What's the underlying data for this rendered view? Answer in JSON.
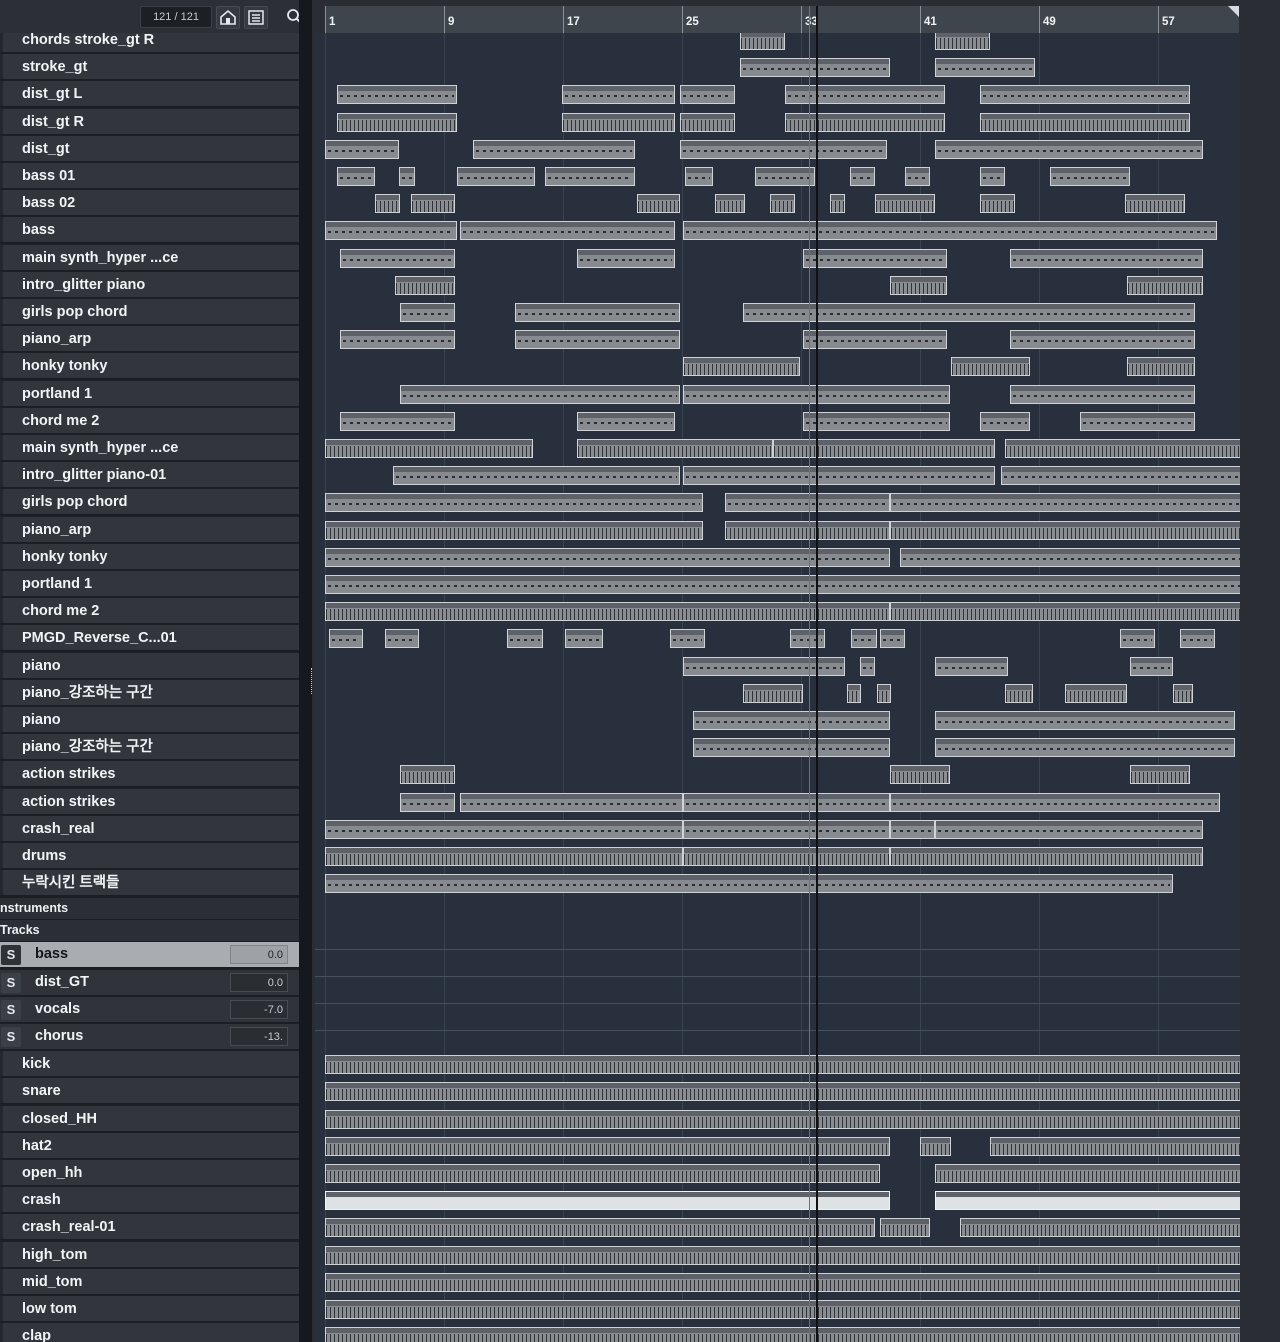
{
  "toolbar": {
    "track_counter": "121 / 121",
    "icons": [
      "home-icon",
      "list-icon",
      "search-icon"
    ]
  },
  "ruler": {
    "bars": [
      "1",
      "9",
      "17",
      "25",
      "33",
      "41",
      "49",
      "57"
    ]
  },
  "tracks_top": [
    "chords stroke_gt R",
    "stroke_gt",
    "dist_gt L",
    "dist_gt R",
    "dist_gt",
    "bass 01",
    "bass 02",
    "bass",
    "main synth_hyper ...ce",
    "intro_glitter piano",
    "girls pop chord",
    "piano_arp",
    "honky tonky",
    "portland 1",
    "chord me 2",
    "main synth_hyper ...ce",
    "intro_glitter piano-01",
    "girls pop chord",
    "piano_arp",
    "honky tonky",
    "portland 1",
    "chord me 2",
    "PMGD_Reverse_C...01",
    "piano",
    "piano_강조하는 구간",
    "piano",
    "piano_강조하는 구간",
    "action strikes",
    "action strikes",
    "crash_real",
    "drums",
    "누락시킨 트랙들"
  ],
  "folders": {
    "instruments": "nstruments",
    "tracks": "Tracks"
  },
  "group_tracks": [
    {
      "solo": "S",
      "name": "bass",
      "volume": "0.0",
      "selected": true
    },
    {
      "solo": "S",
      "name": "dist_GT",
      "volume": "0.0",
      "selected": false
    },
    {
      "solo": "S",
      "name": "vocals",
      "volume": "-7.0",
      "selected": false
    },
    {
      "solo": "S",
      "name": "chorus",
      "volume": "-13.",
      "selected": false
    }
  ],
  "tracks_bottom": [
    "kick",
    "snare",
    "closed_HH",
    "hat2",
    "open_hh",
    "crash",
    "crash_real-01",
    "high_tom",
    "mid_tom",
    "low tom",
    "clap"
  ]
}
